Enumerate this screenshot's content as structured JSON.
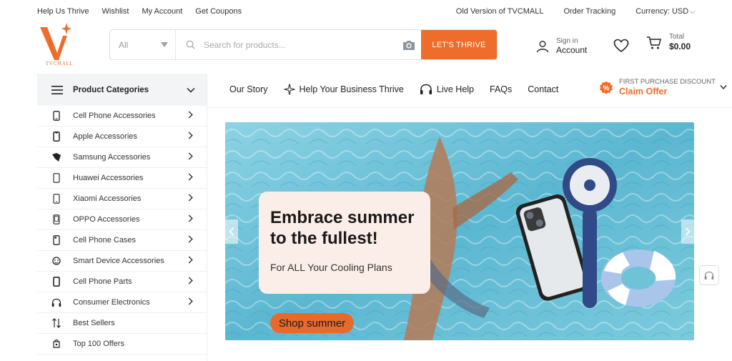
{
  "topbar": {
    "left_links": [
      "Help Us Thrive",
      "Wishlist",
      "My Account",
      "Get Coupons"
    ],
    "old_version": "Old Version of TVCMALL",
    "order_tracking": "Order Tracking",
    "currency": "Currency: USD"
  },
  "logo": {
    "text": "TVCMALL"
  },
  "search": {
    "category": "All",
    "placeholder": "Search for products...",
    "button": "LET'S THRIVE"
  },
  "account": {
    "sign_in": "Sign in",
    "label": "Account"
  },
  "cart": {
    "total_label": "Total",
    "amount": "$0.00"
  },
  "sidebar": {
    "title": "Product Categories",
    "items": [
      {
        "label": "Cell Phone Accessories",
        "icon": "phone-icon",
        "chevron": true
      },
      {
        "label": "Apple Accessories",
        "icon": "apple-phone-icon",
        "chevron": true
      },
      {
        "label": "Samsung Accessories",
        "icon": "samsung-icon",
        "chevron": true
      },
      {
        "label": "Huawei Accessories",
        "icon": "huawei-phone-icon",
        "chevron": true
      },
      {
        "label": "Xiaomi Accessories",
        "icon": "xiaomi-phone-icon",
        "chevron": true
      },
      {
        "label": "OPPO Accessories",
        "icon": "oppo-phone-icon",
        "chevron": true
      },
      {
        "label": "Cell Phone Cases",
        "icon": "phone-case-icon",
        "chevron": true
      },
      {
        "label": "Smart Device Accessories",
        "icon": "smart-device-icon",
        "chevron": true
      },
      {
        "label": "Cell Phone Parts",
        "icon": "phone-parts-icon",
        "chevron": true
      },
      {
        "label": "Consumer Electronics",
        "icon": "headphones-icon",
        "chevron": true
      },
      {
        "label": "Best Sellers",
        "icon": "sort-icon",
        "chevron": false
      },
      {
        "label": "Top 100 Offers",
        "icon": "offer-icon",
        "chevron": false
      }
    ]
  },
  "nav": {
    "our_story": "Our Story",
    "help_business": "Help Your Business Thrive",
    "live_help": "Live Help",
    "faqs": "FAQs",
    "contact": "Contact"
  },
  "promo": {
    "line1": "FIRST PURCHASE DISCOUNT",
    "line2": "Claim Offer"
  },
  "banner": {
    "headline": "Embrace summer to the fullest!",
    "subline": "For ALL Your Cooling Plans",
    "button": "Shop summer"
  },
  "colors": {
    "accent": "#ee6d2b",
    "water": "#6fc3d8"
  }
}
